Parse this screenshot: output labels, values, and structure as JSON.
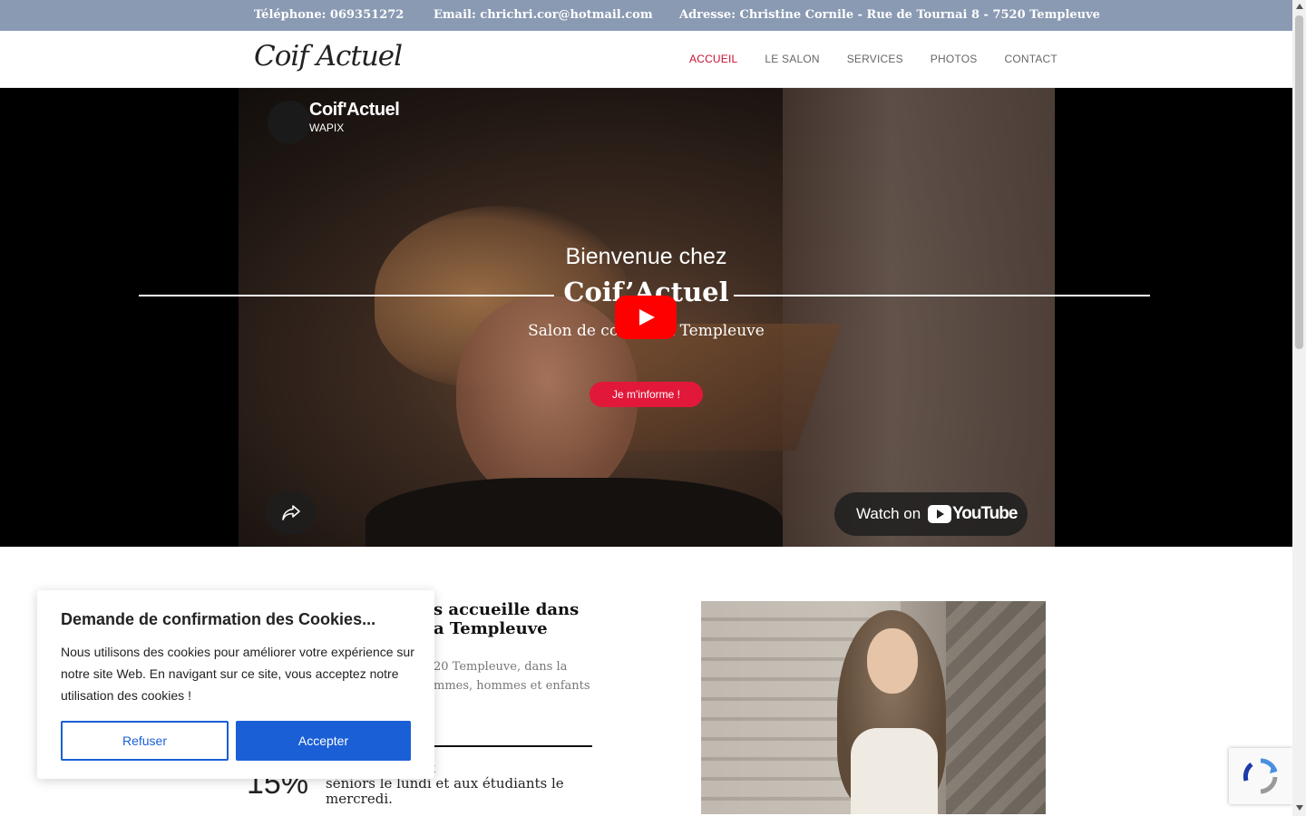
{
  "topbar": {
    "phone": "Téléphone: 069351272",
    "email": "Email: chrichri.cor@hotmail.com",
    "address": "Adresse: Christine Cornile - Rue de Tournai 8 - 7520 Templeuve"
  },
  "nav": {
    "logo": "Coif Actuel",
    "items": [
      {
        "label": "ACCUEIL",
        "active": true
      },
      {
        "label": "LE SALON",
        "active": false
      },
      {
        "label": "SERVICES",
        "active": false
      },
      {
        "label": "PHOTOS",
        "active": false
      },
      {
        "label": "CONTACT",
        "active": false
      }
    ]
  },
  "video": {
    "title": "Coif'Actuel",
    "channel": "WAPIX",
    "watch_on": "Watch on",
    "youtube": "YouTube"
  },
  "hero": {
    "line1": "Bienvenue chez",
    "line2": "Coif’Actuel",
    "line3": "Salon de coiffure à Templeuve",
    "cta": "Je m'informe !"
  },
  "about": {
    "title": "s accueille dans\na Templeuve",
    "text": "20 Templeuve, dans la\nmmes, hommes et enfants",
    "discount": "15%",
    "promo": "nt proposés aux\nséniors le lundi et aux étudiants le\nmercredi."
  },
  "cookie": {
    "title": "Demande de confirmation des Cookies...",
    "text": "Nous utilisons des cookies pour améliorer votre expérience sur notre site Web. En navigant sur ce site, vous acceptez notre utilisation des cookies !",
    "refuse": "Refuser",
    "accept": "Accepter"
  },
  "colors": {
    "topbar": "#8a9ab3",
    "accent": "#e2183a",
    "active_nav": "#c8102e",
    "cookie_button": "#1a5fd6"
  }
}
